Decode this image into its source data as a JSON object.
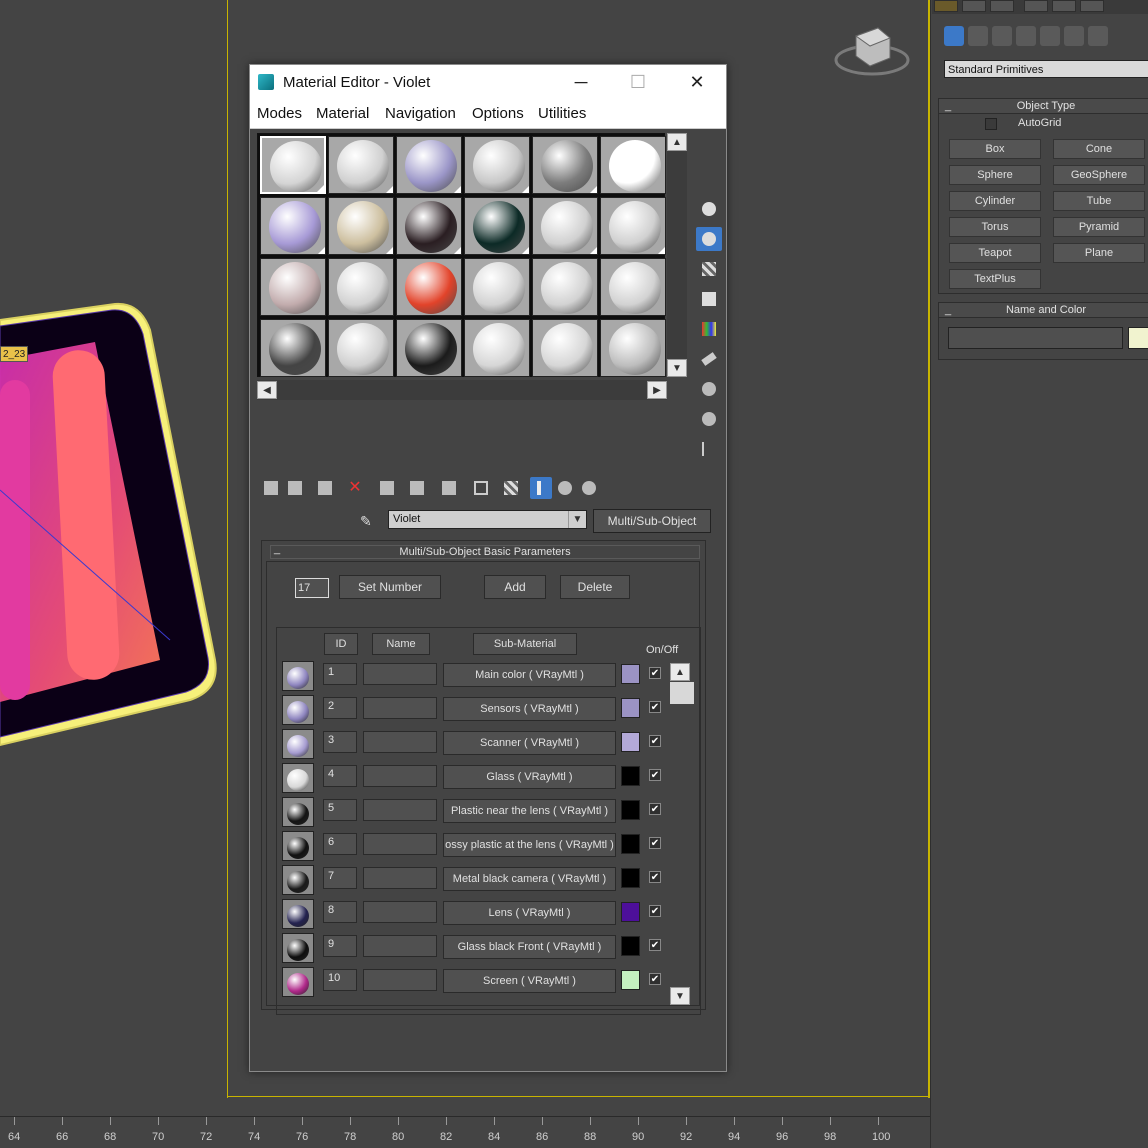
{
  "viewport": {
    "object_label": "2_23",
    "timeline_ticks": [
      "64",
      "66",
      "68",
      "70",
      "72",
      "74",
      "76",
      "78",
      "80",
      "82",
      "84",
      "86",
      "88",
      "90",
      "92",
      "94",
      "96",
      "98",
      "100"
    ]
  },
  "command_panel": {
    "dropdown": "Standard Primitives",
    "object_type": {
      "title": "Object Type",
      "autogrid": "AutoGrid",
      "buttons": [
        "Box",
        "Cone",
        "Sphere",
        "GeoSphere",
        "Cylinder",
        "Tube",
        "Torus",
        "Pyramid",
        "Teapot",
        "Plane",
        "TextPlus"
      ]
    },
    "name_and_color": {
      "title": "Name and Color",
      "swatch_color": "#f1f3cf"
    }
  },
  "material_editor": {
    "title": "Material Editor - Violet",
    "window_controls": {
      "minimize": "─",
      "maximize": "☐",
      "close": "✕"
    },
    "menu": [
      "Modes",
      "Material",
      "Navigation",
      "Options",
      "Utilities"
    ],
    "slots": [
      {
        "color": "#d4d4d4",
        "active": true
      },
      {
        "color": "#d0d0d0",
        "active": false
      },
      {
        "color": "#9b96c8",
        "active": false
      },
      {
        "color": "#c8c8c8",
        "active": false
      },
      {
        "color": "#7d7d7d",
        "active": false
      },
      {
        "color": "#ffffff",
        "active": false
      },
      {
        "color": "#a79ad6",
        "active": false
      },
      {
        "color": "#cdbf9f",
        "active": false
      },
      {
        "color": "#2a1e22",
        "active": false
      },
      {
        "color": "#0c2a26",
        "active": false
      },
      {
        "color": "#d0d0d0",
        "active": false
      },
      {
        "color": "#d0d0d0",
        "active": false
      },
      {
        "color": "#c2acad",
        "active": false
      },
      {
        "color": "#d2d2d2",
        "active": false
      },
      {
        "color": "#e2432a",
        "active": false
      },
      {
        "color": "#d2d2d2",
        "active": false
      },
      {
        "color": "#d2d2d2",
        "active": false
      },
      {
        "color": "#d2d2d2",
        "active": false
      },
      {
        "color": "#444444",
        "active": false
      },
      {
        "color": "#d0d0d0",
        "active": false
      },
      {
        "color": "#1b1b1b",
        "active": false
      },
      {
        "color": "#d6d6d6",
        "active": false
      },
      {
        "color": "#d6d6d6",
        "active": false
      },
      {
        "color": "#bdbdbd",
        "active": false
      }
    ],
    "material_name": "Violet",
    "material_type": "Multi/Sub-Object",
    "params": {
      "title": "Multi/Sub-Object Basic Parameters",
      "set_number_value": "17",
      "set_number_label": "Set Number",
      "add_label": "Add",
      "delete_label": "Delete",
      "headers": {
        "id": "ID",
        "name": "Name",
        "sub_material": "Sub-Material",
        "on_off": "On/Off"
      },
      "rows": [
        {
          "id": "1",
          "sub": "Main color  ( VRayMtl )",
          "color": "#9b93c4",
          "thumb": "#8f86c0"
        },
        {
          "id": "2",
          "sub": "Sensors  ( VRayMtl )",
          "color": "#9b93c4",
          "thumb": "#8f86c0"
        },
        {
          "id": "3",
          "sub": "Scanner  ( VRayMtl )",
          "color": "#b3a9d8",
          "thumb": "#a59bd0"
        },
        {
          "id": "4",
          "sub": "Glass  ( VRayMtl )",
          "color": "#000000",
          "thumb": "#d8d8d8"
        },
        {
          "id": "5",
          "sub": "Plastic near the lens  ( VRayMtl )",
          "color": "#000000",
          "thumb": "#141414"
        },
        {
          "id": "6",
          "sub": "ossy plastic at the lens  ( VRayMtl )",
          "color": "#000000",
          "thumb": "#111111"
        },
        {
          "id": "7",
          "sub": "Metal black camera  ( VRayMtl )",
          "color": "#000000",
          "thumb": "#1a1a1a"
        },
        {
          "id": "8",
          "sub": "Lens  ( VRayMtl )",
          "color": "#4d0f9a",
          "thumb": "#232250"
        },
        {
          "id": "9",
          "sub": "Glass black Front  ( VRayMtl )",
          "color": "#000000",
          "thumb": "#0e0e0e"
        },
        {
          "id": "10",
          "sub": "Screen  ( VRayMtl )",
          "color": "#c5f0c0",
          "thumb": "#b0288a"
        }
      ],
      "check_mark": "✔"
    }
  }
}
